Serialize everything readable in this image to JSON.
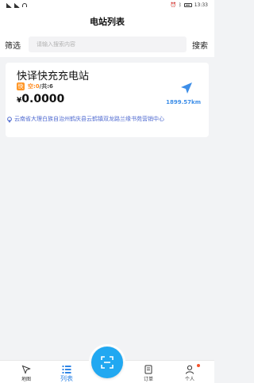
{
  "status": {
    "left_icons": [
      "signal-icon",
      "wifi-icon"
    ],
    "right_text": "13:33",
    "right_icons": [
      "alarm-icon",
      "bluetooth-icon",
      "battery-icon"
    ]
  },
  "header": {
    "title": "电站列表"
  },
  "search": {
    "filter_label": "筛选",
    "placeholder": "请输入搜索内容",
    "button_label": "搜索"
  },
  "stations": [
    {
      "name": "快译快充充电站",
      "badge": "快",
      "free_label": "空:0",
      "total_label": "/共:6",
      "price_currency": "¥",
      "price": "0.0000",
      "distance": "1899.57km",
      "address": "云南省大理白族自治州鹤庆县云鹤镇双龙路兰缘书苑营销中心"
    }
  ],
  "tabbar": {
    "items": [
      {
        "label": "地图",
        "icon": "navigation-arrow-icon"
      },
      {
        "label": "列表",
        "icon": "list-icon",
        "active": true
      },
      {
        "label": "",
        "icon": "scan-icon"
      },
      {
        "label": "订单",
        "icon": "order-icon"
      },
      {
        "label": "个人",
        "icon": "person-icon"
      }
    ]
  },
  "colors": {
    "accent": "#2f86e6",
    "scan": "#21a8f1",
    "badge": "#ff9626",
    "address": "#4f6ad0",
    "notice_dot": "#f5532c"
  }
}
